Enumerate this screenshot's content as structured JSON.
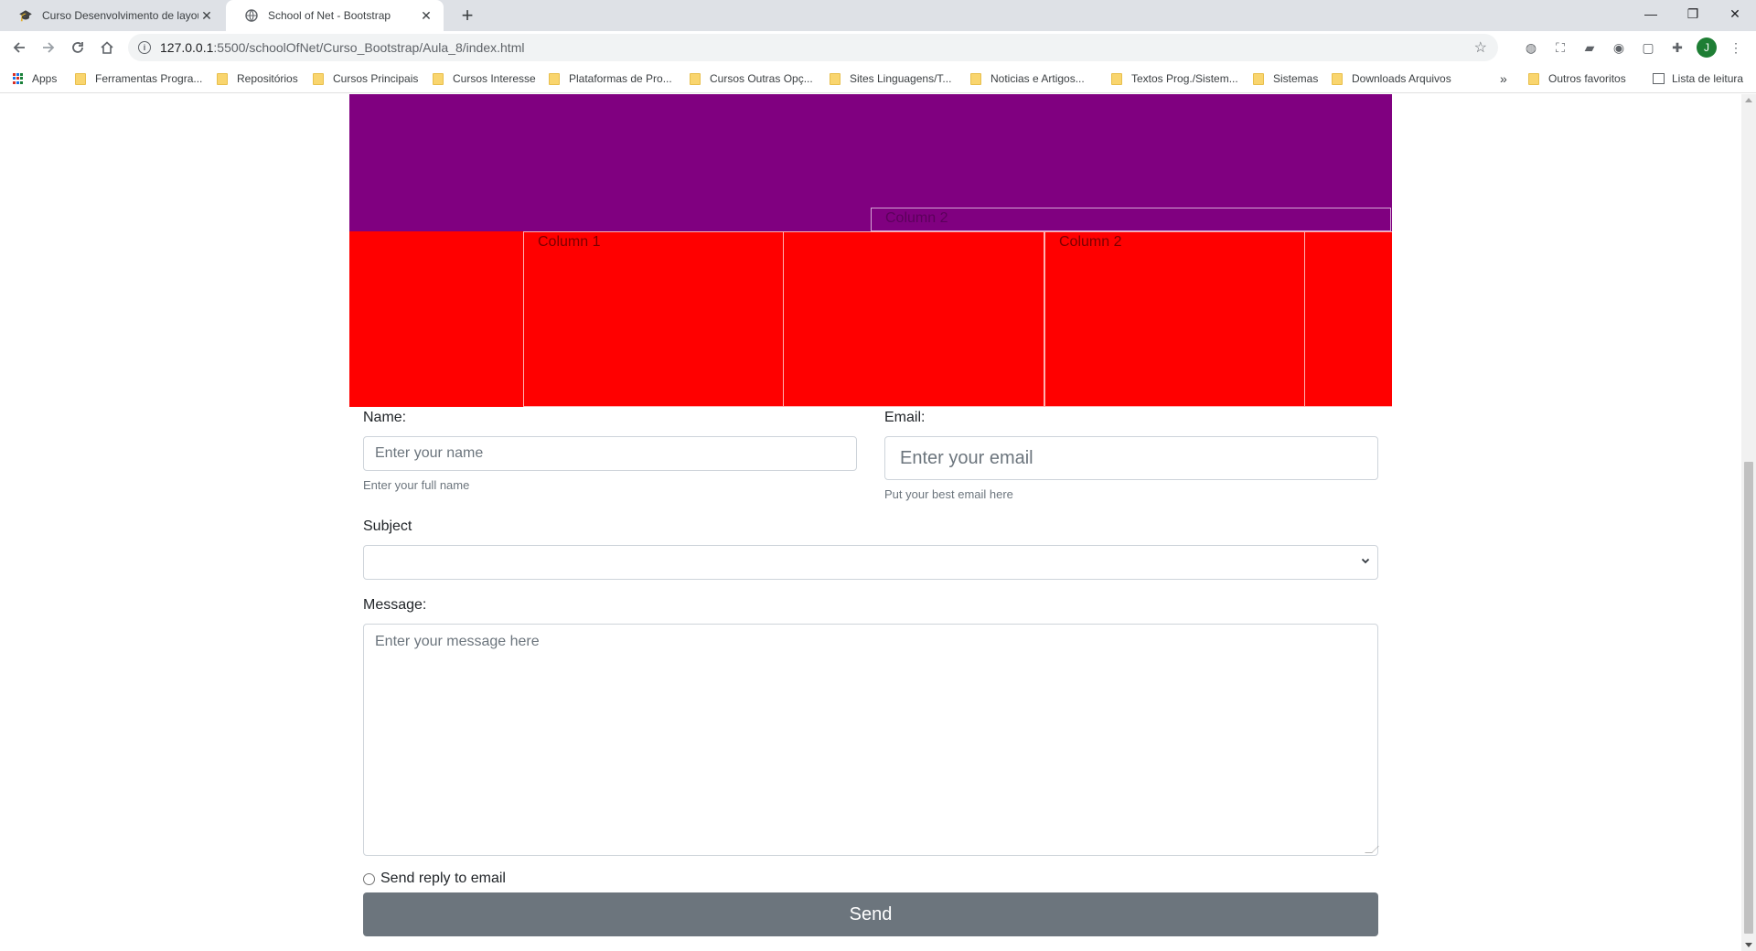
{
  "browser": {
    "tabs": [
      {
        "title": "Curso Desenvolvimento de layout",
        "active": false
      },
      {
        "title": "School of Net - Bootstrap",
        "active": true
      }
    ],
    "url_host": "127.0.0.1",
    "url_path": ":5500/schoolOfNet/Curso_Bootstrap/Aula_8/index.html",
    "profile_initial": "J",
    "bookmarks": {
      "apps": "Apps",
      "items": [
        "Ferramentas Progra...",
        "Repositórios",
        "Cursos Principais",
        "Cursos Interesse",
        "Plataformas de Pro...",
        "Cursos Outras Opç...",
        "Sites Linguagens/T...",
        "Noticias e Artigos...",
        "Textos Prog./Sistem...",
        "Sistemas",
        "Downloads Arquivos"
      ],
      "overflow": "»",
      "other": "Outros favoritos",
      "reading_list": "Lista de leitura"
    }
  },
  "page": {
    "purple_row": {
      "column2_label": "Column 2",
      "color": "#800080"
    },
    "red_row": {
      "column1_label": "Column 1",
      "column2_label": "Column 2",
      "color": "#ff0000"
    },
    "form": {
      "name_label": "Name:",
      "name_placeholder": "Enter your name",
      "name_help": "Enter your full name",
      "email_label": "Email:",
      "email_placeholder": "Enter your email",
      "email_help": "Put your best email here",
      "subject_label": "Subject",
      "subject_value": "",
      "message_label": "Message:",
      "message_placeholder": "Enter your message here",
      "reply_label": "Send reply to email",
      "send_label": "Send",
      "button_color": "#6c757d"
    }
  }
}
